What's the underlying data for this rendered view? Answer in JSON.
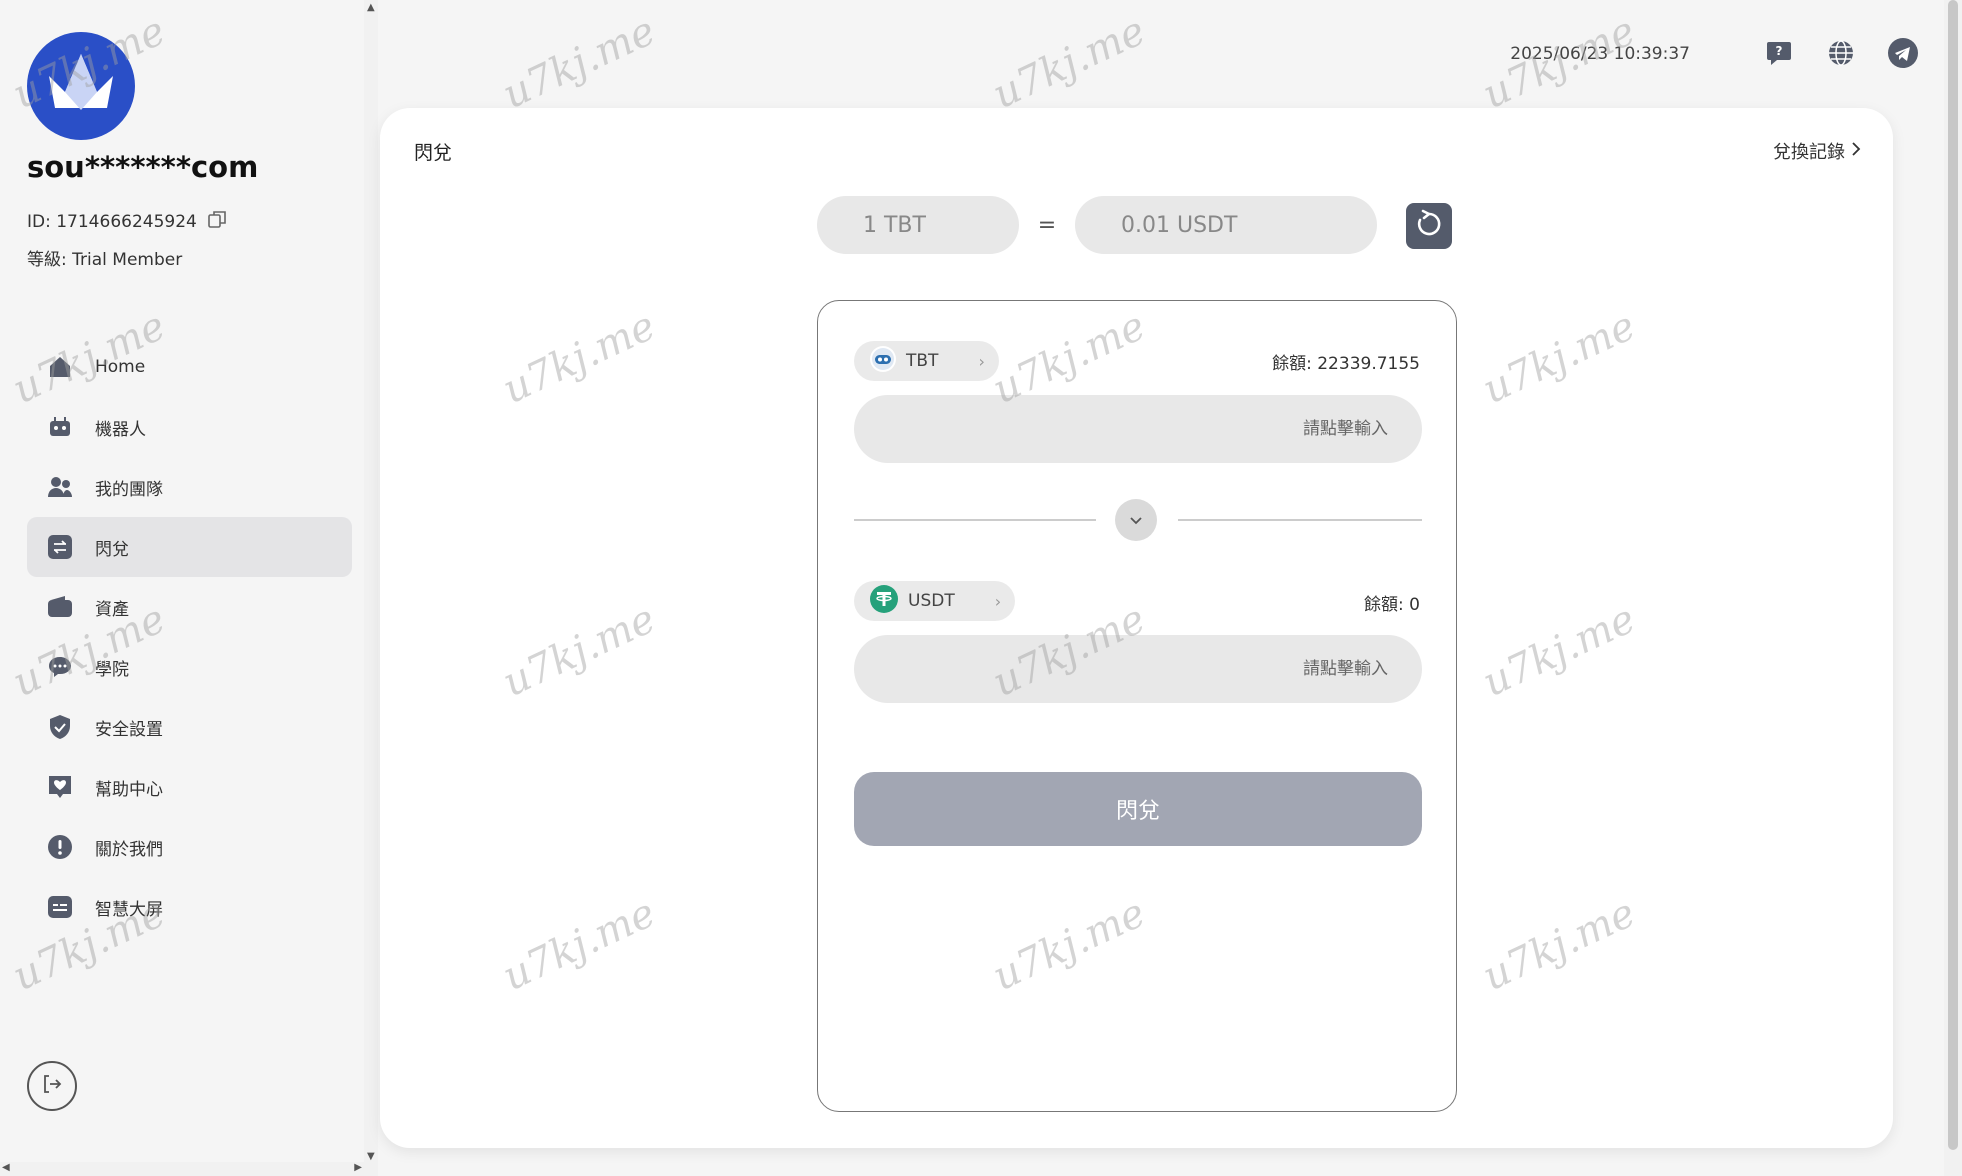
{
  "user": {
    "name": "sou*******com",
    "id_label": "ID: 1714666245924",
    "level_label": "等級: Trial Member"
  },
  "nav": [
    {
      "label": "Home",
      "icon": "home-icon"
    },
    {
      "label": "機器人",
      "icon": "robot-icon"
    },
    {
      "label": "我的團隊",
      "icon": "team-icon"
    },
    {
      "label": "閃兌",
      "icon": "swap-icon",
      "active": true
    },
    {
      "label": "資產",
      "icon": "wallet-icon"
    },
    {
      "label": "學院",
      "icon": "chat-icon"
    },
    {
      "label": "安全設置",
      "icon": "shield-icon"
    },
    {
      "label": "幫助中心",
      "icon": "help-heart-icon"
    },
    {
      "label": "關於我們",
      "icon": "info-icon"
    },
    {
      "label": "智慧大屏",
      "icon": "screen-icon"
    }
  ],
  "header": {
    "datetime": "2025/06/23 10:39:37"
  },
  "card": {
    "title": "閃兌",
    "history_label": "兌換記錄"
  },
  "rate": {
    "from": "1 TBT",
    "equals": "=",
    "to": "0.01 USDT"
  },
  "swap": {
    "from_token": "TBT",
    "from_balance": "餘額: 22339.7155",
    "from_placeholder": "請點擊輸入",
    "to_token": "USDT",
    "to_balance": "餘額: 0",
    "to_placeholder": "請點擊輸入",
    "submit_label": "閃兌"
  },
  "watermark": "u7kj.me",
  "colors": {
    "avatar_bg": "#2a4fc7",
    "accent_dark": "#545b6b",
    "submit_disabled": "#a2a6b3",
    "usdt_green": "#26a17b",
    "tbt_blue": "#2c6fb0"
  }
}
